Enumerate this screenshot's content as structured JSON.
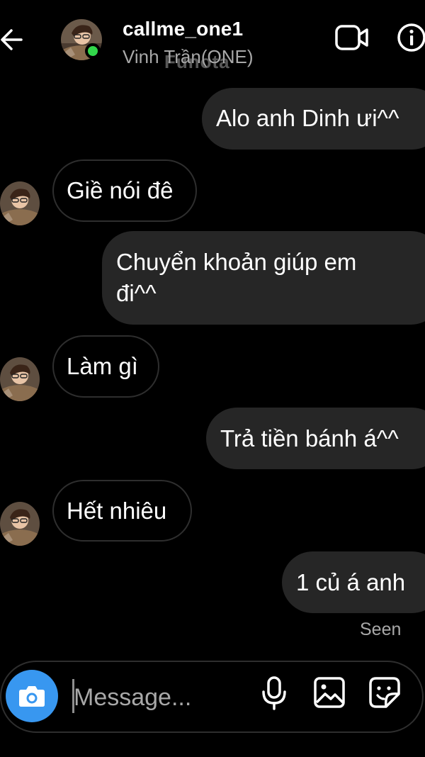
{
  "header": {
    "username": "callme_one1",
    "fullname": "Vinh Trần(ONE)",
    "watermark": "Funota",
    "online_color": "#32d74b"
  },
  "messages": [
    {
      "sender": "me",
      "text": "Alo anh Dinh ưi^^"
    },
    {
      "sender": "them",
      "text": "Giề nói đê"
    },
    {
      "sender": "me",
      "lines": [
        "Chuyển khoản giúp em",
        "đi^^"
      ]
    },
    {
      "sender": "them",
      "text": "Làm gì"
    },
    {
      "sender": "me",
      "text": "Trả tiền bánh á^^"
    },
    {
      "sender": "them",
      "text": "Hết nhiêu"
    },
    {
      "sender": "me",
      "text": "1 củ á anh"
    }
  ],
  "seen_label": "Seen",
  "composer": {
    "placeholder": "Message...",
    "accent": "#3897f0"
  },
  "icons": {
    "back": "arrow-left-icon",
    "video": "video-camera-icon",
    "info": "info-icon",
    "camera": "camera-icon",
    "mic": "microphone-icon",
    "gallery": "gallery-icon",
    "sticker": "sticker-icon"
  }
}
